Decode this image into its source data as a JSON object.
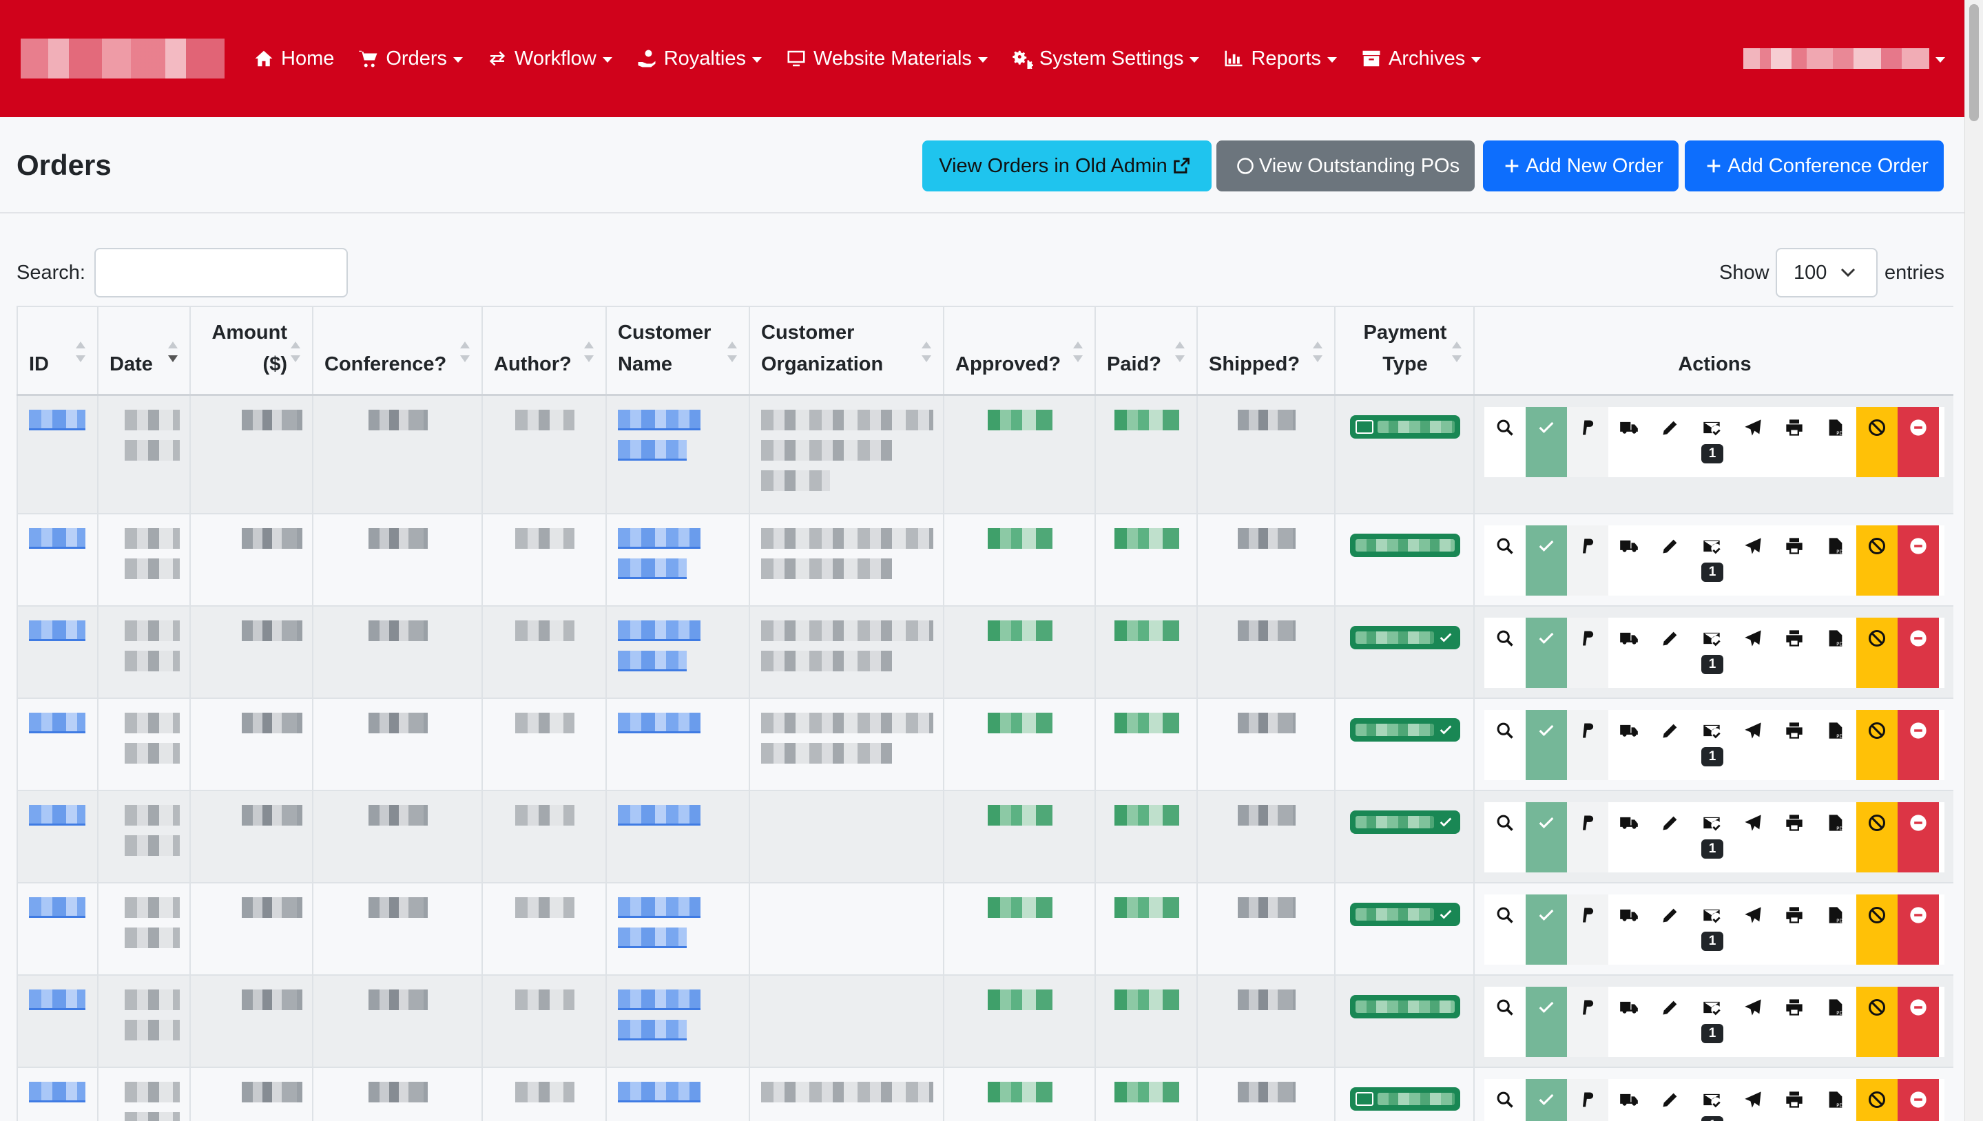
{
  "nav": {
    "items": [
      {
        "label": "Home",
        "icon": "home-icon",
        "caret": false
      },
      {
        "label": "Orders",
        "icon": "cart-icon",
        "caret": true
      },
      {
        "label": "Workflow",
        "icon": "arrows-icon",
        "caret": true
      },
      {
        "label": "Royalties",
        "icon": "hand-coin-icon",
        "caret": true
      },
      {
        "label": "Website Materials",
        "icon": "monitor-icon",
        "caret": true
      },
      {
        "label": "System Settings",
        "icon": "gears-icon",
        "caret": true
      },
      {
        "label": "Reports",
        "icon": "chart-icon",
        "caret": true
      },
      {
        "label": "Archives",
        "icon": "archive-icon",
        "caret": true
      }
    ]
  },
  "header": {
    "title": "Orders",
    "btn_old_admin": "View Orders in Old Admin",
    "btn_outstanding": "View Outstanding POs",
    "btn_add_order": "Add New Order",
    "btn_add_conf": "Add Conference Order"
  },
  "controls": {
    "search_label": "Search:",
    "search_value": "",
    "show_label": "Show",
    "show_value": "100",
    "entries_label": "entries"
  },
  "table": {
    "columns": {
      "id": "ID",
      "date": "Date",
      "amount": "Amount",
      "amount_unit": "($)",
      "conference": "Conference?",
      "author": "Author?",
      "customer_name_1": "Customer",
      "customer_name_2": "Name",
      "customer_org_1": "Customer",
      "customer_org_2": "Organization",
      "approved": "Approved?",
      "paid": "Paid?",
      "shipped": "Shipped?",
      "payment_1": "Payment",
      "payment_2": "Type",
      "actions": "Actions"
    },
    "email_badge": "1",
    "last_row_partial": {
      "date": "03-05",
      "customer": "HARLAND",
      "org": "Memorial School"
    }
  },
  "colors": {
    "navbar": "#d0021b",
    "info": "#1fc4ee",
    "secondary": "#6c757d",
    "primary": "#0d6efd",
    "success": "#198754",
    "approve": "#75b798",
    "warning": "#ffc107",
    "danger": "#dc3545"
  }
}
